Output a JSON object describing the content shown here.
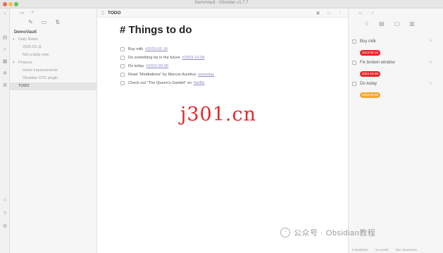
{
  "window": {
    "title": "DemoVault - Obsidian v1.7.7"
  },
  "ribbon": {
    "icons": [
      "files-icon",
      "search-icon",
      "calendar-icon",
      "graph-icon",
      "command-icon",
      "help-icon",
      "settings-icon"
    ]
  },
  "explorer": {
    "vault_name": "DemoVault",
    "items": [
      {
        "label": "Daily Notes",
        "type": "folder",
        "depth": 1
      },
      {
        "label": "2025-03-11",
        "type": "file",
        "depth": 2
      },
      {
        "label": "Not a daily note",
        "type": "file",
        "depth": 2
      },
      {
        "label": "Projects",
        "type": "folder",
        "depth": 1
      },
      {
        "label": "Home improvements",
        "type": "file",
        "depth": 2
      },
      {
        "label": "Obsidian GTD plugin",
        "type": "file",
        "depth": 2
      },
      {
        "label": "TODO",
        "type": "file",
        "depth": 1,
        "active": true
      }
    ]
  },
  "editor": {
    "tab_title": "TODO",
    "heading": "# Things to do",
    "tasks": [
      {
        "text": "Buy milk",
        "link": "#2023-02-18"
      },
      {
        "text": "Do something far in the future",
        "link": "#2023-10-06"
      },
      {
        "text": "Do today",
        "link": "#2022-03-06"
      },
      {
        "text": "Read \"Meditations\" by Marcus Aurelius",
        "link": "someday"
      },
      {
        "text": "Check out \"The Queen's Gambit\" on",
        "link": "Netflix"
      }
    ]
  },
  "overlay": {
    "watermark": "j301.cn",
    "brand": "公众号 · Obsidian教程"
  },
  "right_sidebar": {
    "tasks": [
      {
        "label": "Buy milk",
        "pill": "2023-02-18",
        "color": "#e8262a"
      },
      {
        "label": "Fix broken window",
        "pill": "2023-10-06",
        "color": "#e8262a"
      },
      {
        "label": "Do today",
        "pill": "2022-03-06",
        "color": "#f2a735"
      }
    ]
  },
  "status_bar": {
    "backlinks": "0 backlinks",
    "words": "14 words",
    "characters": "232 characters"
  }
}
